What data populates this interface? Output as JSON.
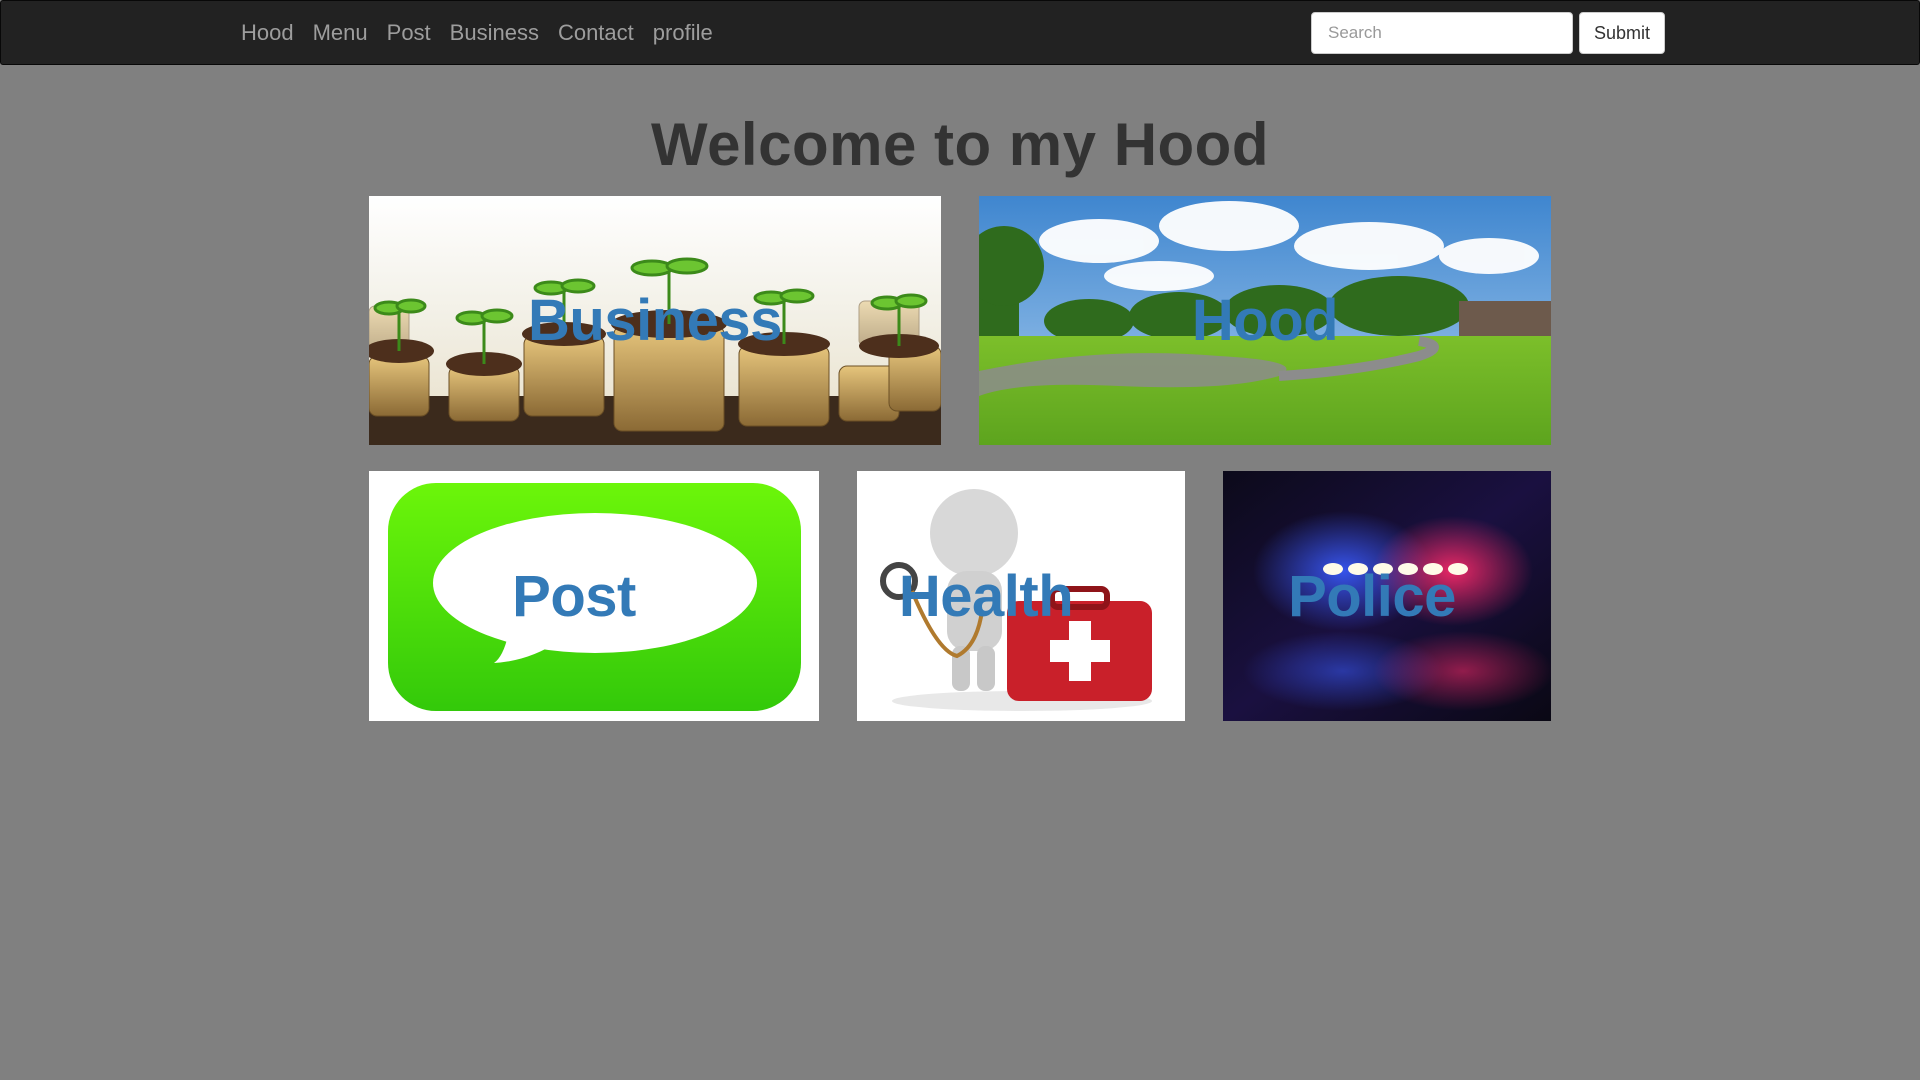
{
  "nav": {
    "links": [
      "Hood",
      "Menu",
      "Post",
      "Business",
      "Contact",
      "profile"
    ],
    "search_placeholder": "Search",
    "submit_label": "Submit"
  },
  "page": {
    "title": "Welcome to my Hood"
  },
  "tiles": {
    "business": {
      "label": "Business",
      "image": "coins-with-seedlings"
    },
    "hood": {
      "label": "Hood",
      "image": "green-campus-lawn"
    },
    "post": {
      "label": "Post",
      "image": "green-speech-bubble"
    },
    "health": {
      "label": "Health",
      "image": "figure-with-stethoscope-and-first-aid-kit"
    },
    "police": {
      "label": "Police",
      "image": "police-siren-lights"
    }
  },
  "colors": {
    "navbar_bg": "#222222",
    "page_bg": "#808080",
    "link": "#9d9d9d",
    "title": "#333333",
    "tile_label": "#337ab7"
  }
}
